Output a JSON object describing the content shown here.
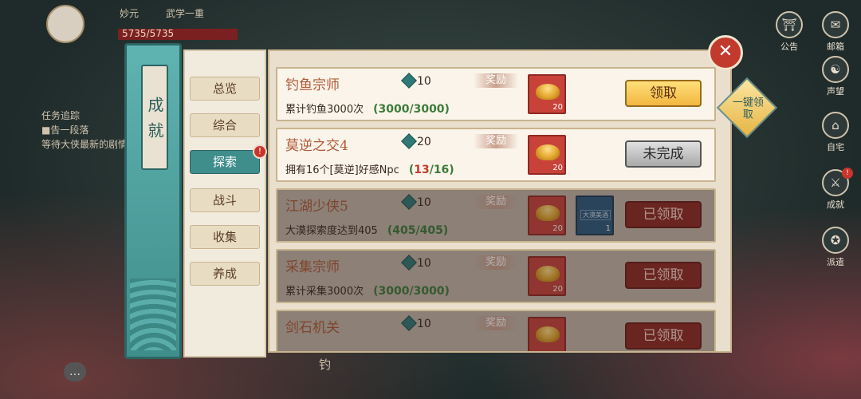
{
  "hud": {
    "player_name": "妙元",
    "player_level": "武学一重",
    "hp": "5735/5735",
    "quest_tracker_title": "任务追踪",
    "quest_line1": "■告一段落",
    "quest_line2": "等待大侠最新的剧情",
    "bottom_text": "钓"
  },
  "side_menu": [
    {
      "label": "公告",
      "icon": "gate-icon"
    },
    {
      "label": "邮箱",
      "icon": "mail-icon"
    },
    {
      "label": "声望",
      "icon": "fame-icon"
    },
    {
      "label": "自宅",
      "icon": "home-icon"
    },
    {
      "label": "成就",
      "icon": "sword-icon",
      "badge": "!"
    },
    {
      "label": "派遣",
      "icon": "dispatch-icon"
    }
  ],
  "window": {
    "title": "成就",
    "close_symbol": "✕",
    "claim_all_label": "一键领取"
  },
  "tabs": [
    {
      "label": "总览",
      "active": false
    },
    {
      "label": "综合",
      "active": false
    },
    {
      "label": "探索",
      "active": true,
      "badge": "!"
    },
    {
      "label": "战斗",
      "active": false
    },
    {
      "label": "收集",
      "active": false
    },
    {
      "label": "养成",
      "active": false
    }
  ],
  "reward_tag_label": "奖励",
  "achievements": [
    {
      "name": "钓鱼宗师",
      "points": "10",
      "desc": "累计钓鱼3000次",
      "progress_prefix": "(",
      "progress_current": "3000",
      "progress_suffix": "/3000)",
      "rewards": [
        {
          "type": "gold-ingot",
          "count": "20"
        }
      ],
      "status": "claimable",
      "button": "领取"
    },
    {
      "name": "莫逆之交4",
      "points": "20",
      "desc": "拥有16个[莫逆]好感Npc",
      "progress_prefix": "(",
      "progress_current": "13",
      "progress_suffix": "/16)",
      "rewards": [
        {
          "type": "gold-ingot",
          "count": "20"
        }
      ],
      "status": "incomplete",
      "button": "未完成"
    },
    {
      "name": "江湖少侠5",
      "points": "10",
      "desc": "大漠探索度达到405",
      "progress_prefix": "(",
      "progress_current": "405",
      "progress_suffix": "/405)",
      "rewards": [
        {
          "type": "gold-ingot",
          "count": "20"
        },
        {
          "type": "item",
          "count": "1",
          "label": "大漠美酒"
        }
      ],
      "status": "claimed",
      "button": "已领取"
    },
    {
      "name": "采集宗师",
      "points": "10",
      "desc": "累计采集3000次",
      "progress_prefix": "(",
      "progress_current": "3000",
      "progress_suffix": "/3000)",
      "rewards": [
        {
          "type": "gold-ingot",
          "count": "20"
        }
      ],
      "status": "claimed",
      "button": "已领取"
    },
    {
      "name": "剑石机关",
      "points": "10",
      "desc": "",
      "progress_prefix": "",
      "progress_current": "",
      "progress_suffix": "",
      "rewards": [
        {
          "type": "gold-ingot",
          "count": ""
        }
      ],
      "status": "claimed",
      "button": "已领取"
    }
  ]
}
